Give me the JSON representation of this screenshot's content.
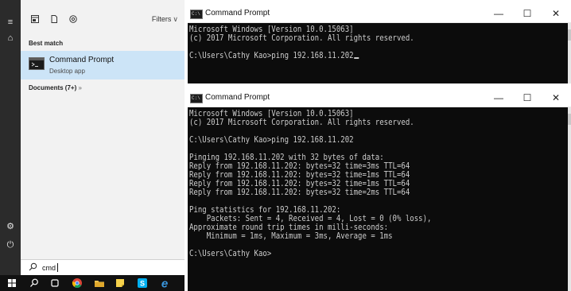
{
  "start_menu": {
    "filters_label": "Filters",
    "best_match_label": "Best match",
    "result": {
      "title": "Command Prompt",
      "subtitle": "Desktop app"
    },
    "documents_label": "Documents (7+)",
    "documents_more": "»",
    "search_text": "cmd"
  },
  "windows": [
    {
      "title": "Command Prompt",
      "lines": [
        "Microsoft Windows [Version 10.0.15063]",
        "(c) 2017 Microsoft Corporation. All rights reserved.",
        "",
        "C:\\Users\\Cathy Kao>ping 192.168.11.202"
      ]
    },
    {
      "title": "Command Prompt",
      "lines": [
        "Microsoft Windows [Version 10.0.15063]",
        "(c) 2017 Microsoft Corporation. All rights reserved.",
        "",
        "C:\\Users\\Cathy Kao>ping 192.168.11.202",
        "",
        "Pinging 192.168.11.202 with 32 bytes of data:",
        "Reply from 192.168.11.202: bytes=32 time=3ms TTL=64",
        "Reply from 192.168.11.202: bytes=32 time=1ms TTL=64",
        "Reply from 192.168.11.202: bytes=32 time=1ms TTL=64",
        "Reply from 192.168.11.202: bytes=32 time=2ms TTL=64",
        "",
        "Ping statistics for 192.168.11.202:",
        "    Packets: Sent = 4, Received = 4, Lost = 0 (0% loss),",
        "Approximate round trip times in milli-seconds:",
        "    Minimum = 1ms, Maximum = 3ms, Average = 1ms",
        "",
        "C:\\Users\\Cathy Kao>"
      ]
    }
  ],
  "window_controls": {
    "minimize": "—",
    "maximize": "☐",
    "close": "✕"
  },
  "icons": {
    "hamburger": "≡",
    "home": "⌂",
    "settings": "⚙",
    "power": "⏻",
    "search": "⌕"
  },
  "colors": {
    "accent_highlight": "#cce4f7",
    "console_bg": "#0c0c0c",
    "console_text": "#cccccc",
    "rail_bg": "#2b2b2b",
    "taskbar_bg": "#111111"
  }
}
